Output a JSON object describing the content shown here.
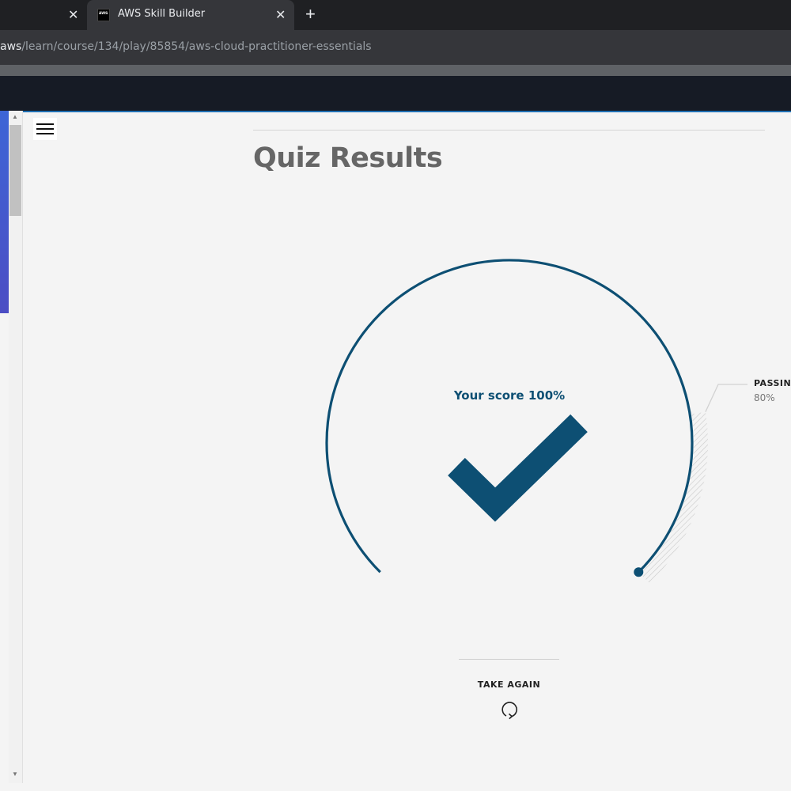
{
  "browser": {
    "active_tab_title": "AWS Skill Builder",
    "favicon_text": "aws",
    "close_glyph": "✕",
    "new_tab_glyph": "+",
    "url_host": "aws",
    "url_path": "/learn/course/134/play/85854/aws-cloud-practitioner-essentials"
  },
  "sidebar": {
    "menu_icon": "hamburger-icon",
    "scroll_up_glyph": "▲",
    "scroll_down_glyph": "▼"
  },
  "quiz": {
    "title": "Quiz Results",
    "score_text": "Your score 100%",
    "score_percent": 100,
    "passing_label": "PASSING",
    "passing_value": "80%",
    "passing_percent": 80,
    "take_again_label": "TAKE AGAIN",
    "result_icon": "checkmark-icon",
    "retry_icon": "retry-icon"
  },
  "colors": {
    "accent": "#0d4f73",
    "title": "#666666",
    "background": "#f4f4f4"
  }
}
